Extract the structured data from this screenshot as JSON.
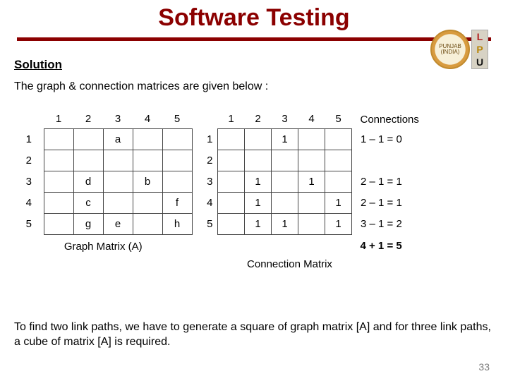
{
  "title": "Software Testing",
  "logo": {
    "seal_text": "PUNJAB (INDIA)",
    "letters": [
      "L",
      "P",
      "U"
    ]
  },
  "section_heading": "Solution",
  "intro_text": "The graph & connection matrices are given below :",
  "graph_matrix": {
    "col_headers": [
      "1",
      "2",
      "3",
      "4",
      "5"
    ],
    "row_headers": [
      "1",
      "2",
      "3",
      "4",
      "5"
    ],
    "cells": [
      [
        "",
        "",
        "a",
        "",
        ""
      ],
      [
        "",
        "",
        "",
        "",
        ""
      ],
      [
        "",
        "d",
        "",
        "b",
        ""
      ],
      [
        "",
        "c",
        "",
        "",
        "f"
      ],
      [
        "",
        "g",
        "e",
        "",
        "h"
      ]
    ],
    "caption": "Graph Matrix (A)"
  },
  "connection_matrix": {
    "col_headers": [
      "1",
      "2",
      "3",
      "4",
      "5"
    ],
    "connections_header": "Connections",
    "row_headers": [
      "1",
      "2",
      "3",
      "4",
      "5"
    ],
    "cells": [
      [
        "",
        "",
        "1",
        "",
        ""
      ],
      [
        "",
        "",
        "",
        "",
        ""
      ],
      [
        "",
        "1",
        "",
        "1",
        ""
      ],
      [
        "",
        "1",
        "",
        "",
        "1"
      ],
      [
        "",
        "1",
        "1",
        "",
        "1"
      ]
    ],
    "connections": [
      "1 – 1 = 0",
      "",
      "2 – 1 = 1",
      "2 – 1 = 1",
      "3 – 1 = 2"
    ],
    "sum": "4 + 1 = 5",
    "caption": "Connection Matrix"
  },
  "outro_text": "To find two link paths, we have to generate a square of graph matrix [A] and for three link paths, a cube of matrix [A] is required.",
  "page_number": "33",
  "chart_data": [
    {
      "type": "table",
      "title": "Graph Matrix (A)",
      "row_labels": [
        "1",
        "2",
        "3",
        "4",
        "5"
      ],
      "col_labels": [
        "1",
        "2",
        "3",
        "4",
        "5"
      ],
      "values": [
        [
          "",
          "",
          "a",
          "",
          ""
        ],
        [
          "",
          "",
          "",
          "",
          ""
        ],
        [
          "",
          "d",
          "",
          "b",
          ""
        ],
        [
          "",
          "c",
          "",
          "",
          "f"
        ],
        [
          "",
          "g",
          "e",
          "",
          "h"
        ]
      ]
    },
    {
      "type": "table",
      "title": "Connection Matrix",
      "row_labels": [
        "1",
        "2",
        "3",
        "4",
        "5"
      ],
      "col_labels": [
        "1",
        "2",
        "3",
        "4",
        "5",
        "Connections"
      ],
      "values": [
        [
          "",
          "",
          "1",
          "",
          "",
          "1 – 1 = 0"
        ],
        [
          "",
          "",
          "",
          "",
          "",
          ""
        ],
        [
          "",
          "1",
          "",
          "1",
          "",
          "2 – 1 = 1"
        ],
        [
          "",
          "1",
          "",
          "",
          "1",
          "2 – 1 = 1"
        ],
        [
          "",
          "1",
          "1",
          "",
          "1",
          "3 – 1 = 2"
        ]
      ],
      "annotations": [
        "Sum: 4 + 1 = 5"
      ]
    }
  ]
}
